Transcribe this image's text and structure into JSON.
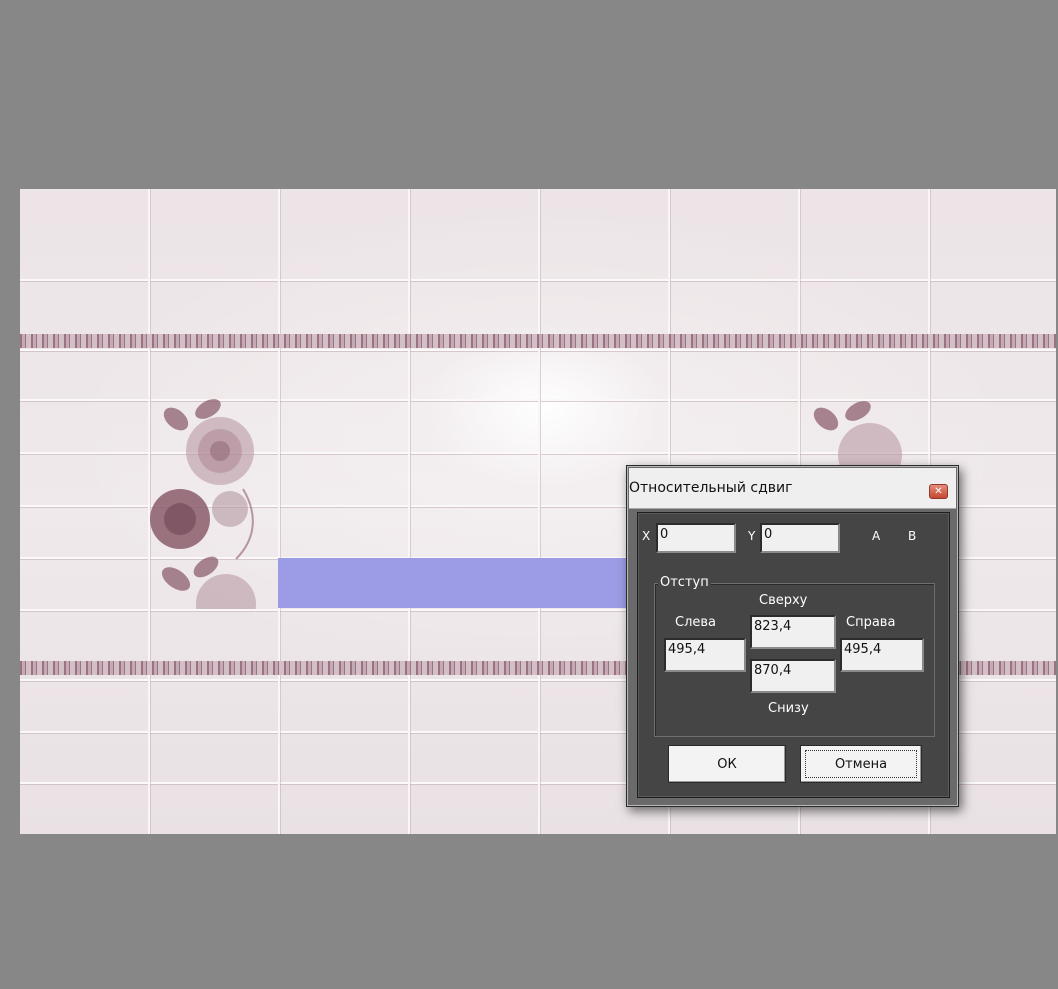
{
  "dialog": {
    "title": "Относительный сдвиг",
    "close_icon": "close-icon",
    "x_label": "X",
    "x_value": "0",
    "y_label": "Y",
    "y_value": "0",
    "a_label": "A",
    "b_label": "B",
    "group_label": "Отступ",
    "top_label": "Сверху",
    "top_value": "823,4",
    "left_label": "Слева",
    "left_value": "495,4",
    "right_label": "Справа",
    "right_value": "495,4",
    "bottom_value": "870,4",
    "bottom_label": "Снизу",
    "ok_label": "ОК",
    "cancel_label": "Отмена"
  },
  "colors": {
    "background": "#878787",
    "selection": "#9c9ce6",
    "dialog_client": "#454545",
    "close_button": "#c44830"
  }
}
